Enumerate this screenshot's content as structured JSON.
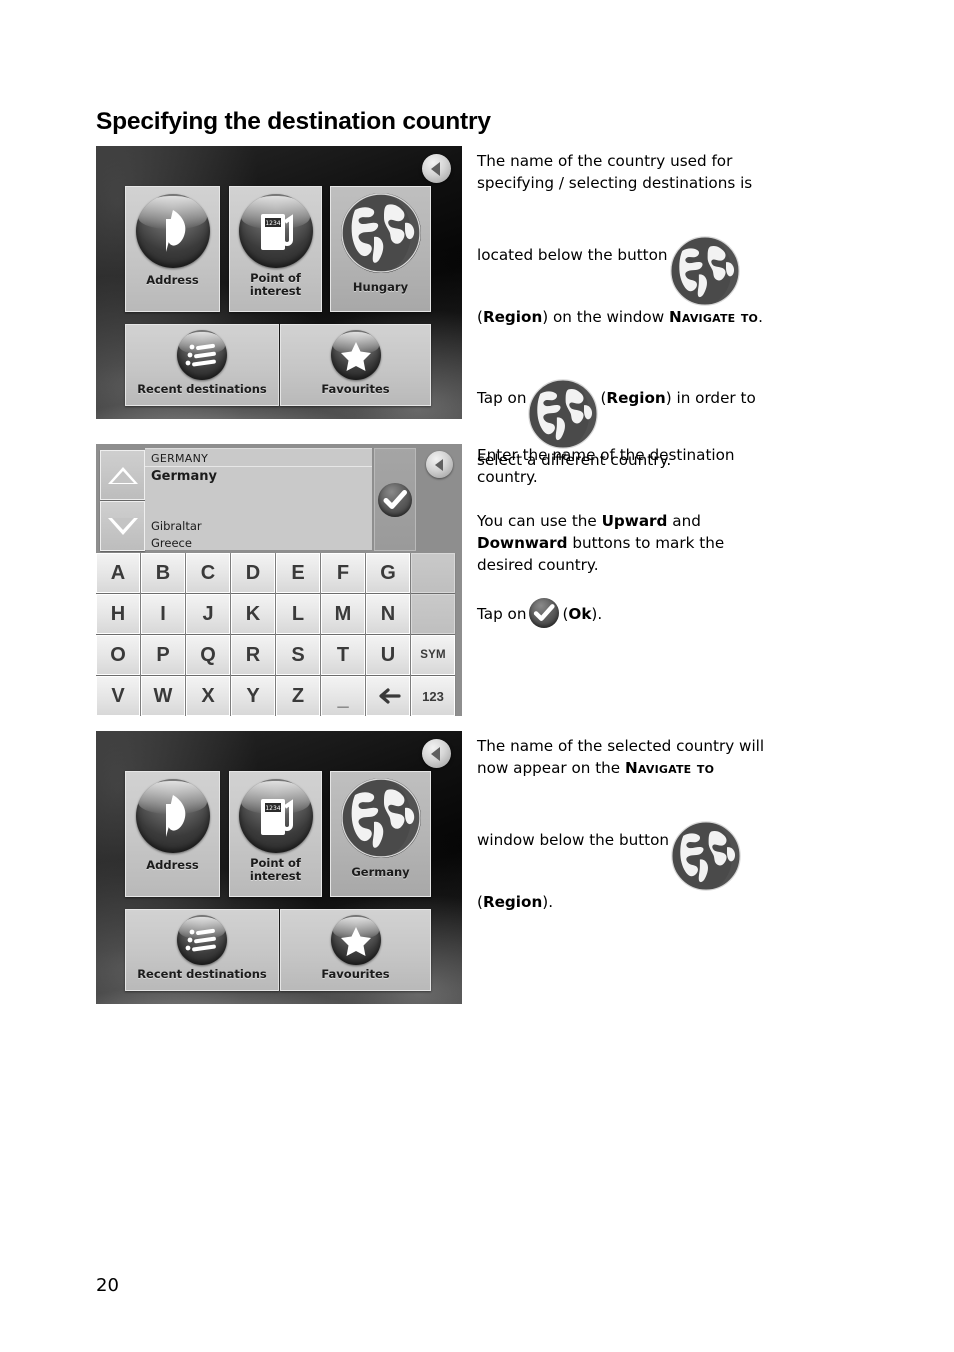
{
  "document": {
    "title": "Specifying the destination country",
    "page_number": "20"
  },
  "screens": {
    "navigate_to_hungary": {
      "tiles": [
        {
          "label": "Address",
          "icon": "flag-pin-icon"
        },
        {
          "label": "Point of\ninterest",
          "icon": "fuel-pump-icon"
        },
        {
          "label": "Hungary",
          "icon": "globe-icon"
        },
        {
          "label": "Recent destinations",
          "icon": "list-icon"
        },
        {
          "label": "Favourites",
          "icon": "star-icon"
        }
      ],
      "back_button": "back-arrow-icon"
    },
    "navigate_to_germany": {
      "tiles": [
        {
          "label": "Address",
          "icon": "flag-pin-icon"
        },
        {
          "label": "Point of\ninterest",
          "icon": "fuel-pump-icon"
        },
        {
          "label": "Germany",
          "icon": "globe-icon"
        },
        {
          "label": "Recent destinations",
          "icon": "list-icon"
        },
        {
          "label": "Favourites",
          "icon": "star-icon"
        }
      ],
      "back_button": "back-arrow-icon"
    },
    "keyboard": {
      "typed_text": "GERMANY",
      "matched_entry": "Germany",
      "other_entries": [
        "Gibraltar",
        "Greece"
      ],
      "upward_button": "triangle-up-icon",
      "downward_button": "triangle-down-icon",
      "ok_button": "checkmark-icon",
      "back_button": "back-arrow-icon",
      "rows": [
        [
          "A",
          "B",
          "C",
          "D",
          "E",
          "F",
          "G",
          ""
        ],
        [
          "H",
          "I",
          "J",
          "K",
          "L",
          "M",
          "N",
          ""
        ],
        [
          "O",
          "P",
          "Q",
          "R",
          "S",
          "T",
          "U",
          "SYM"
        ],
        [
          "V",
          "W",
          "X",
          "Y",
          "Z",
          "_",
          "←",
          "123"
        ]
      ]
    }
  },
  "body": {
    "p1_line1": "The name of the country used for",
    "p1_line2": "specifying / selecting destinations is",
    "p1_line3_before": "located below the button",
    "p1_line4_a": "(",
    "p1_line4_region": "Region",
    "p1_line4_b": ") on the window ",
    "p1_line4_window": "Navigate to",
    "p1_line4_c": ".",
    "p2_tap": "Tap on",
    "p2_a": "(",
    "p2_region": "Region",
    "p2_b": ") in order to",
    "p2_line2": "select a different country.",
    "p3_line1": "Enter the name of the destination",
    "p3_line2": "country.",
    "p4_a": "You can use the ",
    "p4_upward": "Upward",
    "p4_b": " and",
    "p4_downward": "Downward",
    "p4_c": " buttons to mark the",
    "p4_line3": "desired country.",
    "p5_tap": "Tap on",
    "p5_a": "(",
    "p5_ok": "Ok",
    "p5_b": ").",
    "p6_line1": "The name of the selected country will",
    "p6_line2_a": "now appear on the ",
    "p6_line2_window": "Navigate to",
    "p6_line3": "window below the button",
    "p6_line4_a": "(",
    "p6_line4_region": "Region",
    "p6_line4_b": ")."
  }
}
